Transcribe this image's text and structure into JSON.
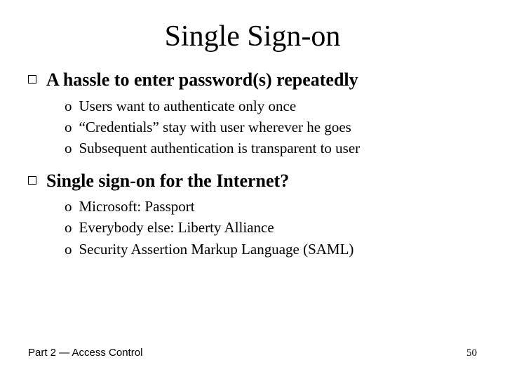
{
  "title": "Single Sign-on",
  "items": [
    {
      "text": "A hassle to enter password(s) repeatedly",
      "sub": [
        "Users want to authenticate only once",
        "“Credentials” stay with user wherever he goes",
        "Subsequent authentication is transparent to user"
      ]
    },
    {
      "text": "Single sign-on for the Internet?",
      "sub": [
        "Microsoft: Passport",
        "Everybody else: Liberty Alliance",
        "Security Assertion Markup Language (SAML)"
      ]
    }
  ],
  "footer_left": "Part 2 — Access Control",
  "footer_right": "50"
}
